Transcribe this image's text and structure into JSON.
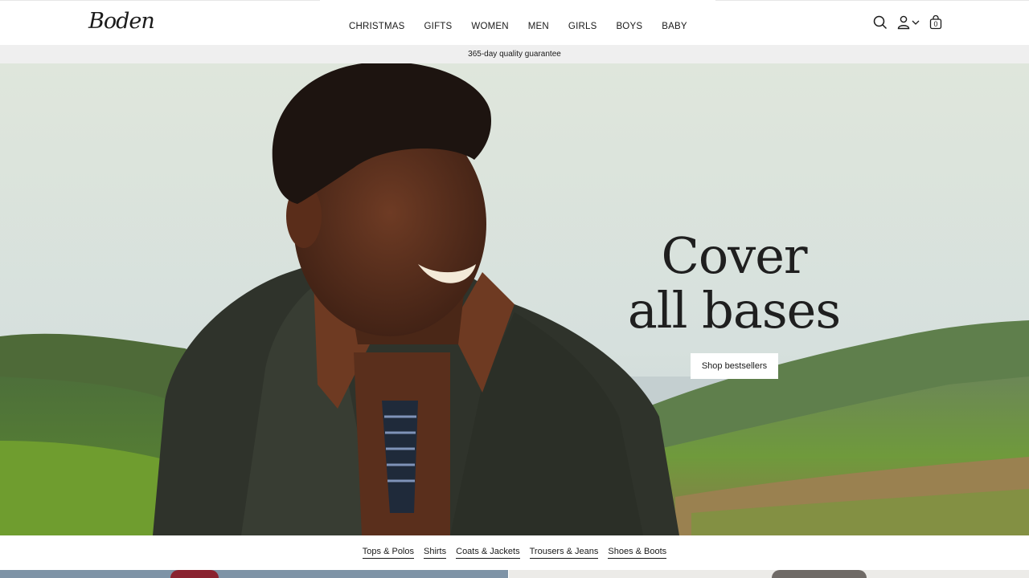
{
  "header": {
    "logo": "Boden",
    "nav": [
      "CHRISTMAS",
      "GIFTS",
      "WOMEN",
      "MEN",
      "GIRLS",
      "BOYS",
      "BABY"
    ],
    "icons": {
      "search": "search-icon",
      "account": "user-icon",
      "account_chevron": "chevron-down-icon",
      "bag": "bag-icon"
    },
    "bag_count": "0"
  },
  "promo": {
    "text": "365-day quality guarantee"
  },
  "hero": {
    "title_line1": "Cover",
    "title_line2": "all bases",
    "button": "Shop bestsellers"
  },
  "categories": [
    "Tops & Polos",
    "Shirts",
    "Coats & Jackets",
    "Trousers & Jeans",
    "Shoes & Boots"
  ],
  "colors": {
    "promo_bg": "#efefef",
    "text": "#1a1a1a",
    "button_bg": "#ffffff"
  }
}
